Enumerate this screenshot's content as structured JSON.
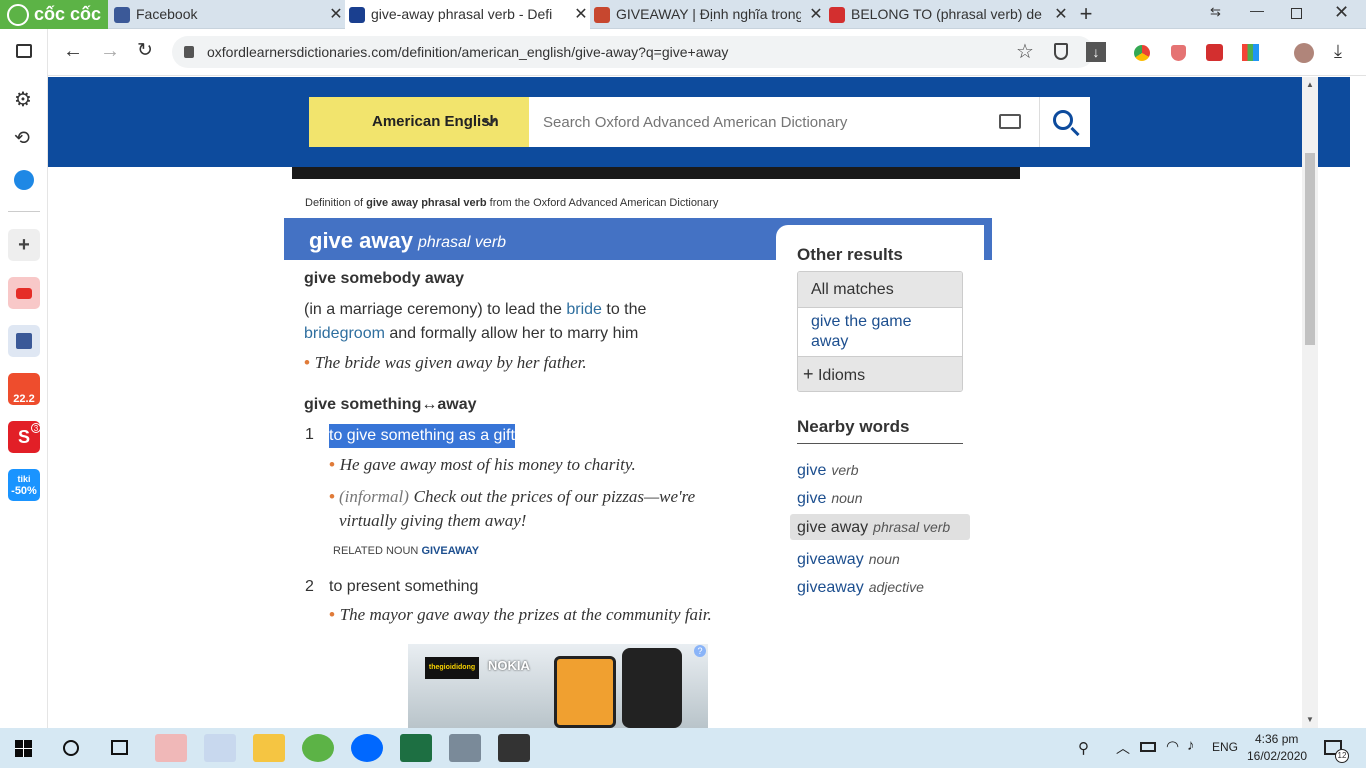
{
  "browser": {
    "logo_text": "cốc cốc",
    "tabs": [
      {
        "title": "Facebook",
        "icon": "facebook-icon",
        "active": false
      },
      {
        "title": "give-away phrasal verb - Defi",
        "icon": "oxford-icon",
        "active": true
      },
      {
        "title": "GIVEAWAY | Định nghĩa trong",
        "icon": "cambridge-icon",
        "active": false
      },
      {
        "title": "BELONG TO (phrasal verb) de",
        "icon": "macmillan-icon",
        "active": false
      }
    ],
    "new_tab_label": "+",
    "url": "oxfordlearnersdictionaries.com/definition/american_english/give-away?q=give+away"
  },
  "sidebar": {
    "badges": {
      "shopee": "22.2",
      "sendo": "3",
      "tiki_brand": "tiki",
      "tiki_discount": "-50%"
    }
  },
  "header": {
    "dictionary_label": "American English",
    "search_placeholder": "Search Oxford Advanced American Dictionary"
  },
  "entry": {
    "definition_prefix": "Definition of",
    "definition_term": "give away phrasal verb",
    "definition_suffix": "from the Oxford Advanced American Dictionary",
    "headword": "give away",
    "pos": "phrasal verb",
    "sense_groups": [
      {
        "phrase": "give somebody away",
        "definition_parts": [
          {
            "text": "(in a marriage ceremony) to lead the ",
            "link": false
          },
          {
            "text": "bride",
            "link": true
          },
          {
            "text": " to the ",
            "link": false
          },
          {
            "text": "bridegroom",
            "link": true
          },
          {
            "text": " and formally allow her to marry him",
            "link": false
          }
        ],
        "example": "The bride was given away by her father."
      }
    ],
    "phrase2": "give something↔away",
    "senses": [
      {
        "number": "1",
        "definition": "to give something as a gift",
        "examples": [
          {
            "label": "",
            "text": "He gave away most of his money to charity."
          },
          {
            "label": "(informal)",
            "text": "Check out the prices of our pizzas—we're virtually giving them away!"
          }
        ],
        "related_label": "RELATED NOUN",
        "related_word": "GIVEAWAY"
      },
      {
        "number": "2",
        "definition": "to present something",
        "examples": [
          {
            "label": "",
            "text": "The mayor gave away the prizes at the community fair."
          }
        ]
      }
    ]
  },
  "other_results": {
    "title": "Other results",
    "all_matches": "All matches",
    "match_items": [
      "give the game away"
    ],
    "idioms": "Idioms"
  },
  "nearby": {
    "title": "Nearby words",
    "items": [
      {
        "word": "give",
        "pos": "verb",
        "selected": false
      },
      {
        "word": "give",
        "pos": "noun",
        "selected": false
      },
      {
        "word": "give away",
        "pos": "phrasal verb",
        "selected": true
      },
      {
        "word": "giveaway",
        "pos": "noun",
        "selected": false
      },
      {
        "word": "giveaway",
        "pos": "adjective",
        "selected": false
      }
    ]
  },
  "ad": {
    "brand": "NOKIA",
    "store": "thegioididong"
  },
  "taskbar": {
    "tray_language": "ENG",
    "time": "4:36 pm",
    "date": "16/02/2020",
    "notification_count": "12"
  },
  "colors": {
    "header_blue": "#0d4b9d",
    "entry_blue": "#4472c4",
    "dictionary_yellow": "#f2e46d",
    "selection": "#3875d7",
    "link": "#1d4f8f",
    "bullet": "#e07b39"
  }
}
